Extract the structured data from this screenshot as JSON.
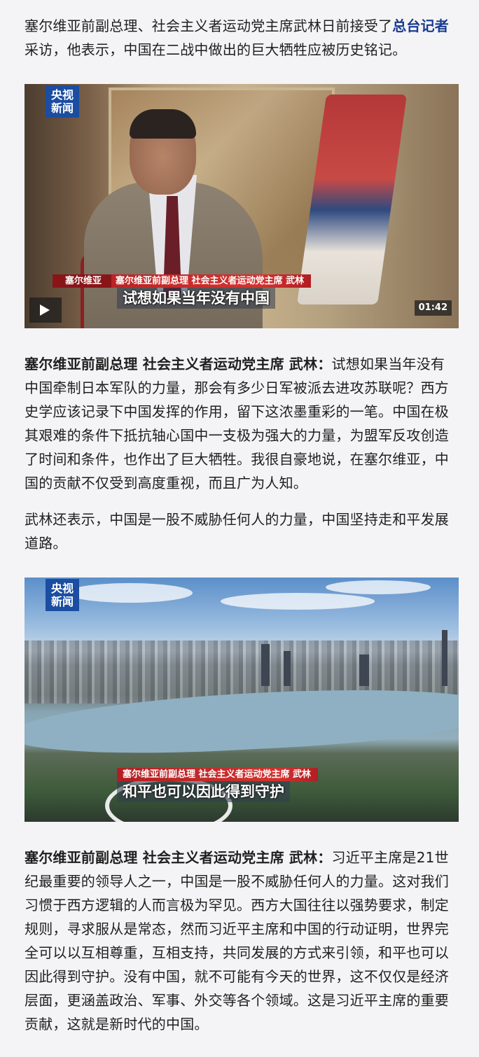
{
  "intro": {
    "text_before": "塞尔维亚前副总理、社会主义者运动党主席武林日前接受了",
    "link_text": "总台记者",
    "text_after": "采访，他表示，中国在二战中做出的巨大牺牲应被历史铭记。"
  },
  "video1": {
    "logo_line1": "央视",
    "logo_line2": "新闻",
    "caption_name": "塞尔维亚",
    "caption_role": "塞尔维亚前副总理 社会主义者运动党主席 武林",
    "caption_main": "试想如果当年没有中国",
    "play_icon": "play-icon",
    "duration": "01:42"
  },
  "para1": {
    "speaker": "塞尔维亚前副总理 社会主义者运动党主席 武林：",
    "text": "试想如果当年没有中国牵制日本军队的力量，那会有多少日军被派去进攻苏联呢？西方史学应该记录下中国发挥的作用，留下这浓墨重彩的一笔。中国在极其艰难的条件下抵抗轴心国中一支极为强大的力量，为盟军反攻创造了时间和条件，也作出了巨大牺牲。我很自豪地说，在塞尔维亚，中国的贡献不仅受到高度重视，而且广为人知。"
  },
  "para2": {
    "text": "武林还表示，中国是一股不威胁任何人的力量，中国坚持走和平发展道路。"
  },
  "image2": {
    "logo_line1": "央视",
    "logo_line2": "新闻",
    "caption_role": "塞尔维亚前副总理 社会主义者运动党主席 武林",
    "caption_main": "和平也可以因此得到守护"
  },
  "para3": {
    "speaker": "塞尔维亚前副总理 社会主义者运动党主席 武林：",
    "text": "习近平主席是21世纪最重要的领导人之一，中国是一股不威胁任何人的力量。这对我们习惯于西方逻辑的人而言极为罕见。西方大国往往以强势要求，制定规则，寻求服从是常态，然而习近平主席和中国的行动证明，世界完全可以以互相尊重，互相支持，共同发展的方式来引领，和平也可以因此得到守护。没有中国，就不可能有今天的世界，这不仅仅是经济层面，更涵盖政治、军事、外交等各个领域。这是习近平主席的重要贡献，这就是新时代的中国。"
  },
  "colors": {
    "link": "#1a3c8f",
    "logo_bg": "#1b4da1",
    "caption_red": "#d33330",
    "text": "#1f1f1f",
    "page_bg": "#f4f4f6"
  }
}
